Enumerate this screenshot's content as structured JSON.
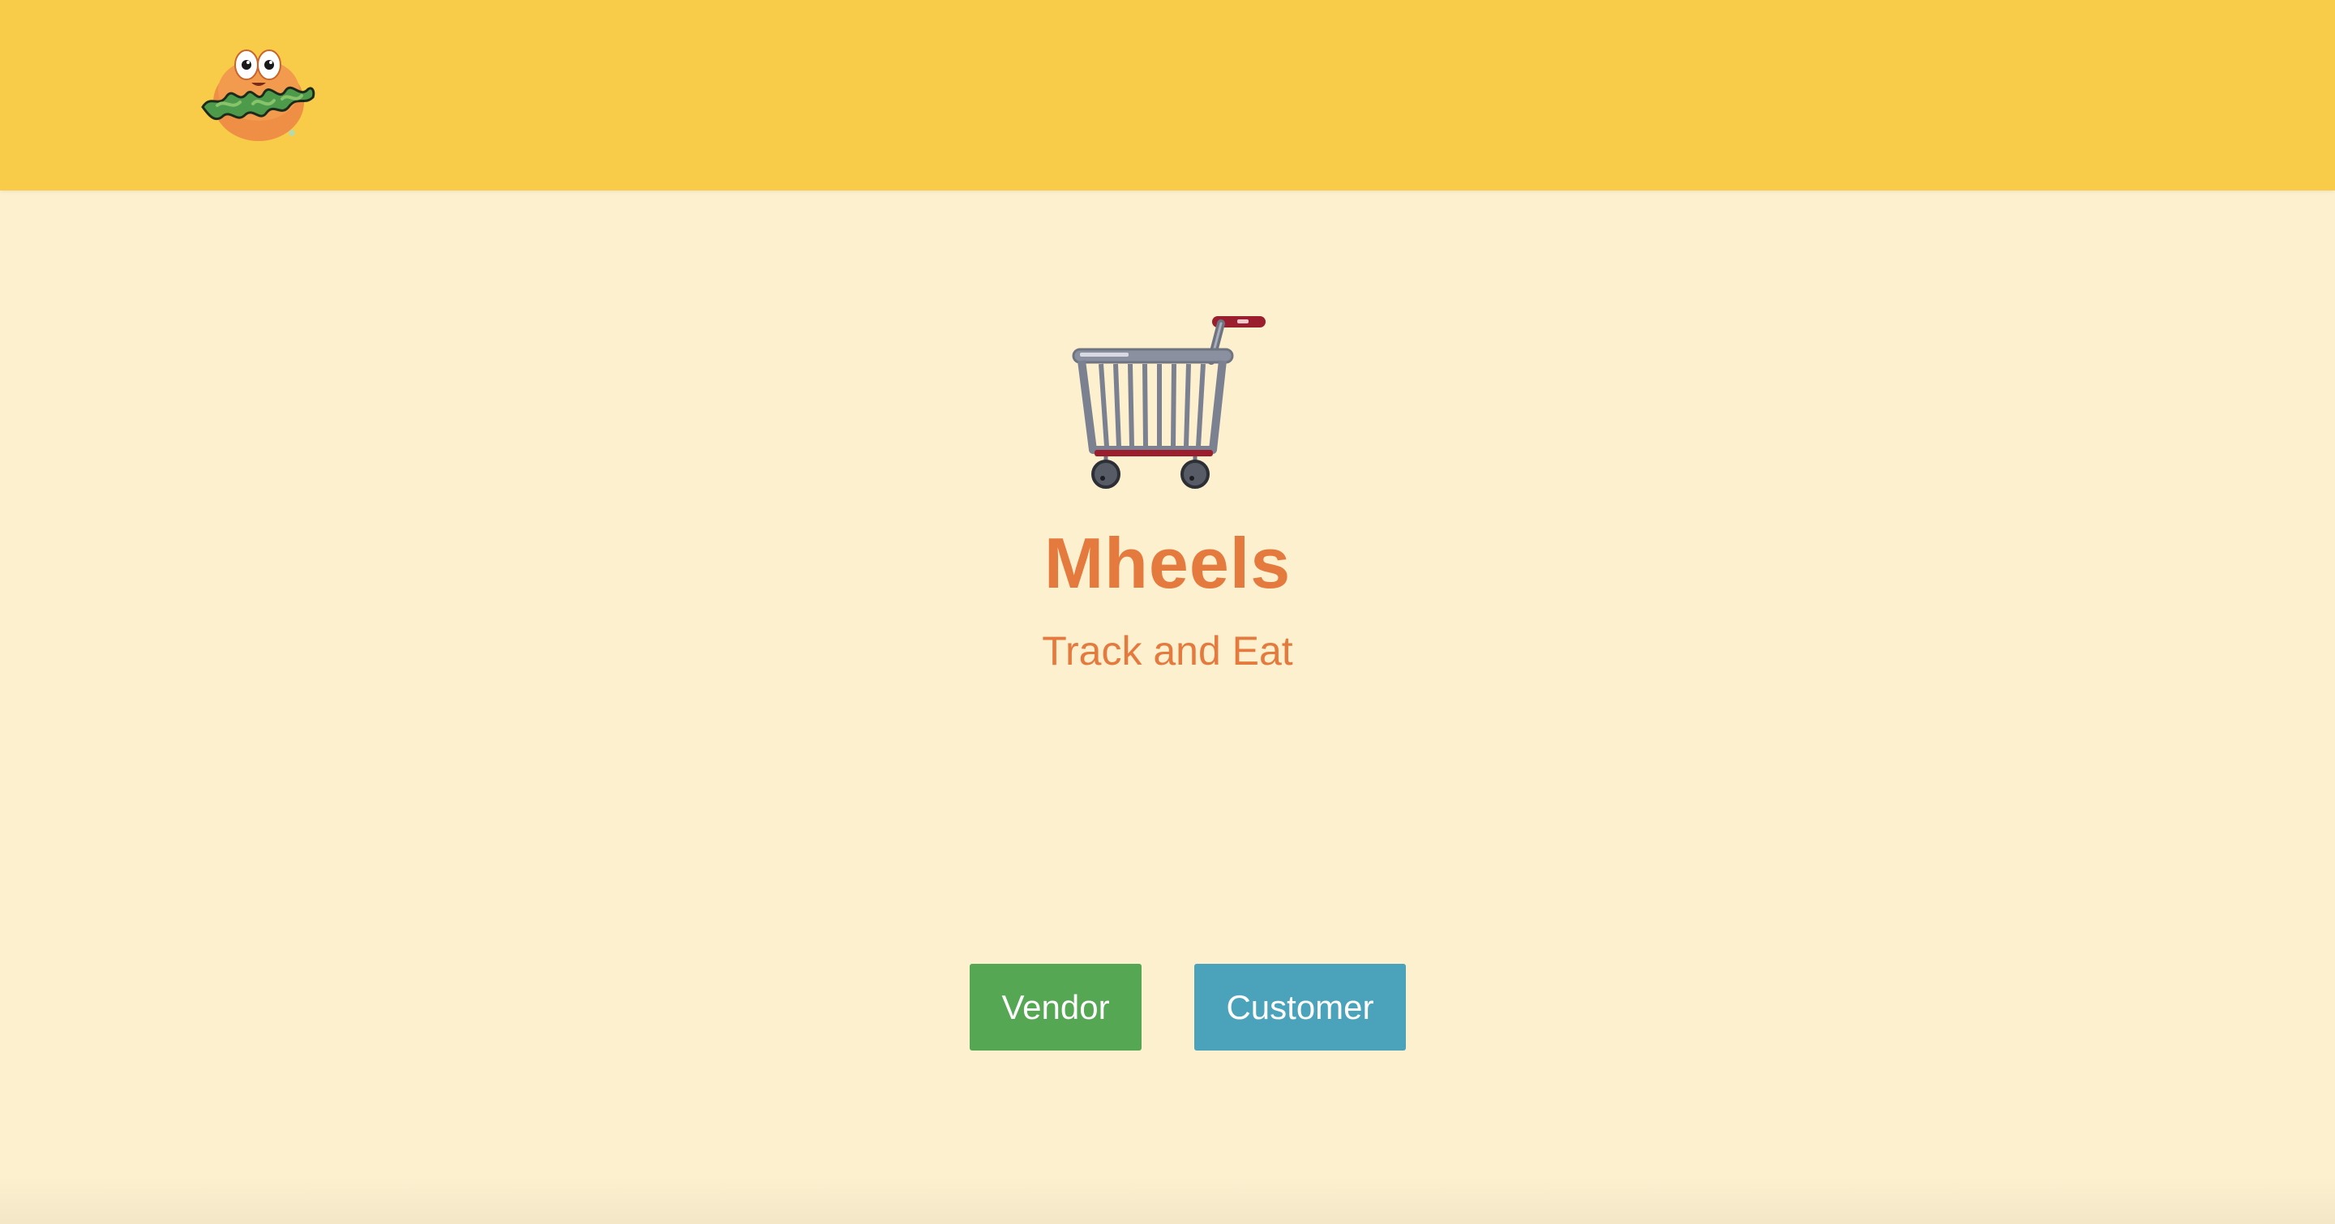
{
  "header": {
    "logo_icon": "burger-mascot-logo",
    "background_color": "#f8cc48"
  },
  "hero": {
    "icon": "shopping-cart-icon",
    "title": "Mheels",
    "subtitle": "Track and Eat",
    "accent_color": "#e57a3f"
  },
  "actions": {
    "vendor_label": "Vendor",
    "customer_label": "Customer",
    "vendor_color": "#55a753",
    "customer_color": "#4aa3bb"
  },
  "page": {
    "background_color": "#fcf0cf"
  }
}
